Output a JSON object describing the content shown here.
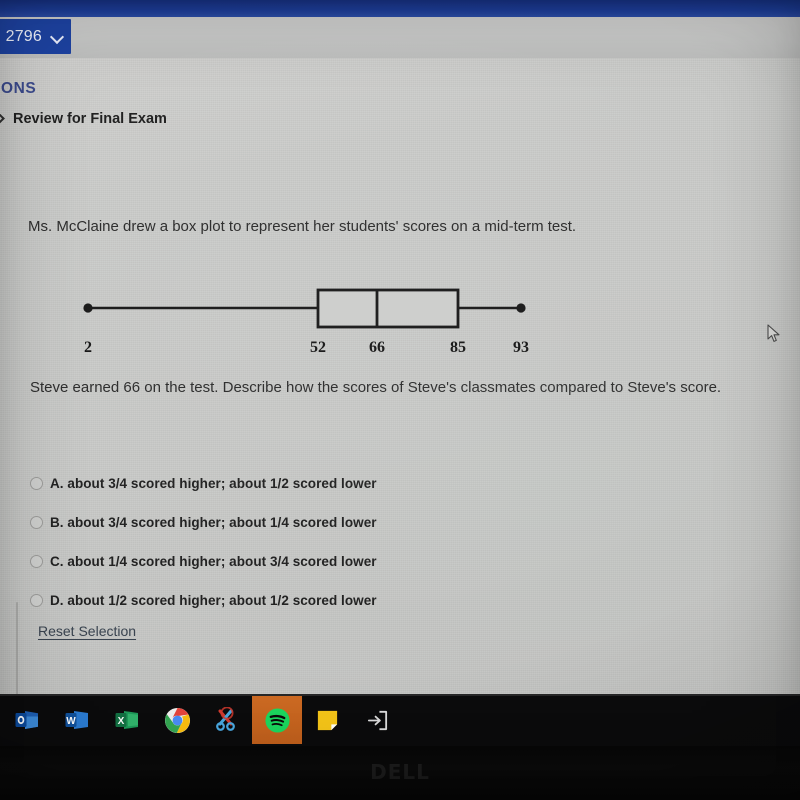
{
  "browser": {
    "id_button_label": "2796",
    "chevron_icon": "chevron-down-icon"
  },
  "sidebar": {
    "section_header": "SONS",
    "lesson_item": "Review for Final Exam",
    "lesson_chevron_icon": "chevron-right-icon"
  },
  "question": {
    "stem": "Ms. McClaine drew a box plot to represent her students' scores on a mid-term test.",
    "prompt": "Steve earned 66 on the test. Describe how the scores of Steve's classmates compared to Steve's score.",
    "options": [
      {
        "id": "A",
        "label": "A. about 3/4 scored higher; about 1/2 scored lower",
        "selected": false
      },
      {
        "id": "B",
        "label": "B. about 3/4 scored higher; about 1/4 scored lower",
        "selected": false
      },
      {
        "id": "C",
        "label": "C. about 1/4 scored higher; about 3/4 scored lower",
        "selected": false
      },
      {
        "id": "D",
        "label": "D. about 1/2 scored higher; about 1/2 scored lower",
        "selected": false
      }
    ],
    "reset_label": "Reset Selection"
  },
  "chart_data": {
    "type": "box",
    "title": "",
    "orientation": "horizontal",
    "labels": [
      "2",
      "52",
      "66",
      "85",
      "93"
    ],
    "min": 2,
    "q1": 52,
    "median": 66,
    "q3": 85,
    "max": 93,
    "axis_visible": false,
    "grid": false,
    "line_color": "#1a1a1a",
    "box_fill": "#cccdcb"
  },
  "taskbar": {
    "items": [
      {
        "name": "outlook-icon",
        "label": "Outlook",
        "active": false
      },
      {
        "name": "word-icon",
        "label": "Word",
        "active": false
      },
      {
        "name": "excel-icon",
        "label": "Excel",
        "active": false
      },
      {
        "name": "chrome-icon",
        "label": "Google Chrome",
        "active": false
      },
      {
        "name": "snipping-tool-icon",
        "label": "Snipping Tool",
        "active": false
      },
      {
        "name": "spotify-icon",
        "label": "Spotify",
        "active": true
      },
      {
        "name": "sticky-notes-icon",
        "label": "Sticky Notes",
        "active": false
      },
      {
        "name": "logout-icon",
        "label": "Sign Out",
        "active": false
      }
    ]
  },
  "device": {
    "brand_logo": "DELL"
  },
  "colors": {
    "browser_blue": "#1d42a0",
    "top_bar_blue": "#1c3c95",
    "page_gray": "#c8c9c7",
    "accent_orange": "#c9621f",
    "text_dark": "#2b2b2b",
    "link_gray": "#39434f"
  }
}
